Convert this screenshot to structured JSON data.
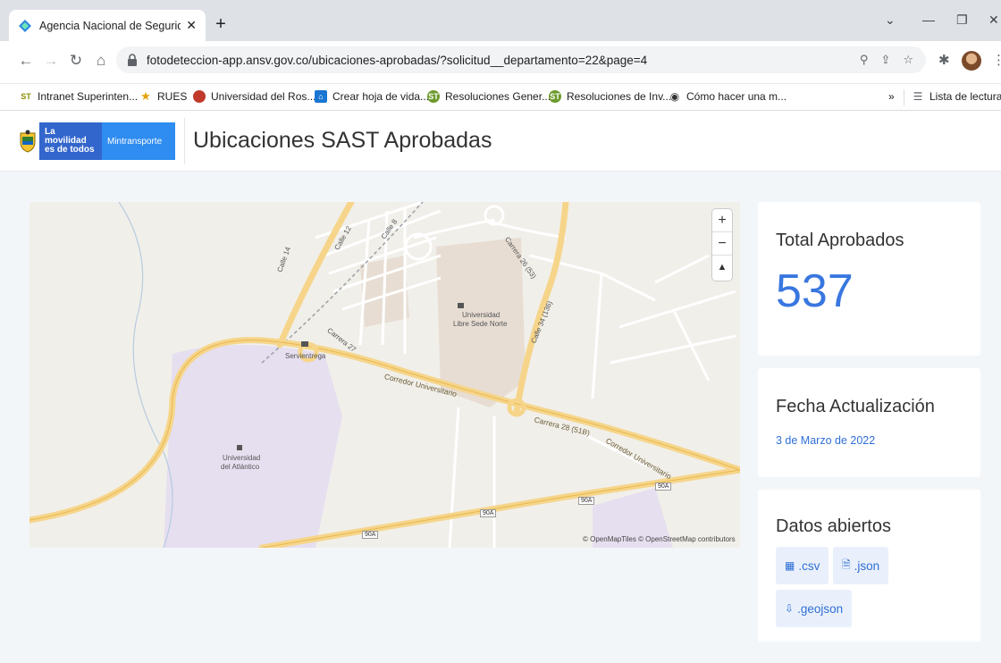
{
  "browser": {
    "tab_title": "Agencia Nacional de Seguridad \\",
    "tab_close": "✕",
    "new_tab": "+",
    "url": "fotodeteccion-app.ansv.gov.co/ubicaciones-aprobadas/?solicitud__departamento=22&page=4",
    "bookmarks": [
      {
        "label": "Intranet Superinten...",
        "icon": "st-icon",
        "color": "#8b8f00"
      },
      {
        "label": "RUES",
        "icon": "star-icon",
        "color": "#e5a100"
      },
      {
        "label": "Universidad del Ros...",
        "icon": "crest-icon",
        "color": "#c0392b"
      },
      {
        "label": "Crear hoja de vida...",
        "icon": "home-icon",
        "color": "#1976d2"
      },
      {
        "label": "Resoluciones Gener...",
        "icon": "st-icon",
        "color": "#6d9a2c"
      },
      {
        "label": "Resoluciones de Inv...",
        "icon": "st-icon",
        "color": "#6d9a2c"
      },
      {
        "label": "Cómo hacer una m...",
        "icon": "eye-icon",
        "color": "#333333"
      }
    ],
    "more_bookmarks": "»",
    "reading_list": "Lista de lectura"
  },
  "header": {
    "logo_line1": "La movilidad",
    "logo_line2": "es de todos",
    "logo_ministry": "Mintransporte",
    "title": "Ubicaciones SAST Aprobadas"
  },
  "map": {
    "zoom_in": "+",
    "zoom_out": "−",
    "compass": "▲",
    "attribution": "© OpenMapTiles © OpenStreetMap contributors",
    "labels": {
      "calle14": "Calle 14",
      "calle12": "Calle 12",
      "calle8": "Calle 8",
      "carrera26": "Carrera 26 (53)",
      "calle34": "Calle 34 (136)",
      "ulibre1": "Universidad",
      "ulibre2": "Libre Sede Norte",
      "carrera27": "Carrera 27",
      "servientrega": "Servientrega",
      "corredor1": "Corredor Universitario",
      "carrera28": "Carrera 28 (51B)",
      "corredor2": "Corredor Universitario",
      "uatl1": "Universidad",
      "uatl2": "del Atlántico",
      "route": "90A"
    }
  },
  "cards": {
    "total_title": "Total Aprobados",
    "total_value": "537",
    "fecha_title": "Fecha Actualización",
    "fecha_value": "3 de Marzo de 2022",
    "datos_title": "Datos abiertos",
    "csv": ".csv",
    "json": ".json",
    "geojson": ".geojson"
  }
}
